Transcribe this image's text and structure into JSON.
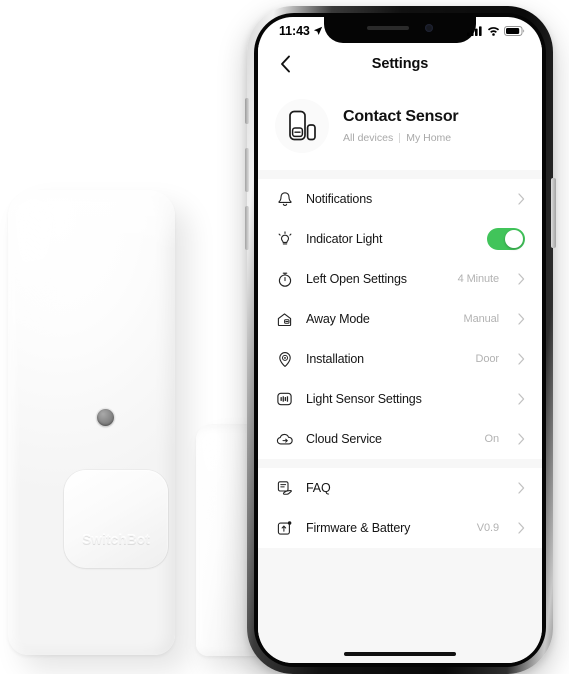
{
  "scene": {
    "product": {
      "brand_logo_text": "SwitchBot",
      "led_indicator_name": "led-indicator-dot"
    }
  },
  "phone": {
    "status_bar": {
      "time": "11:43",
      "location_icon": "location-arrow-icon",
      "signal_icon": "cellular-signal-icon",
      "wifi_icon": "wifi-icon",
      "battery_icon": "battery-icon"
    },
    "nav": {
      "back_icon": "chevron-left-icon",
      "title": "Settings"
    },
    "home_indicator": "home-indicator"
  },
  "device": {
    "icon": "contact-sensor-icon",
    "name": "Contact Sensor",
    "group": "All devices",
    "home": "My Home"
  },
  "settings": {
    "group_main": [
      {
        "icon": "bell-icon",
        "label": "Notifications",
        "value": "",
        "control": "chevron"
      },
      {
        "icon": "lightbulb-icon",
        "label": "Indicator Light",
        "value": "",
        "control": "toggle",
        "toggle_on": true
      },
      {
        "icon": "stopwatch-icon",
        "label": "Left Open Settings",
        "value": "4 Minute",
        "control": "chevron"
      },
      {
        "icon": "home-away-icon",
        "label": "Away Mode",
        "value": "Manual",
        "control": "chevron"
      },
      {
        "icon": "location-pin-icon",
        "label": "Installation",
        "value": "Door",
        "control": "chevron"
      },
      {
        "icon": "light-sensor-icon",
        "label": "Light Sensor Settings",
        "value": "",
        "control": "chevron"
      },
      {
        "icon": "cloud-icon",
        "label": "Cloud Service",
        "value": "On",
        "control": "chevron"
      }
    ],
    "group_support": [
      {
        "icon": "faq-icon",
        "label": "FAQ",
        "value": "",
        "control": "chevron"
      },
      {
        "icon": "firmware-upload-icon",
        "label": "Firmware & Battery",
        "value": "V0.9",
        "control": "chevron"
      }
    ]
  },
  "colors": {
    "toggle_on": "#41c45a",
    "screen_bg": "#f7f7f7",
    "card_bg": "#ffffff",
    "label": "#151515",
    "value": "#b2b2b2"
  }
}
